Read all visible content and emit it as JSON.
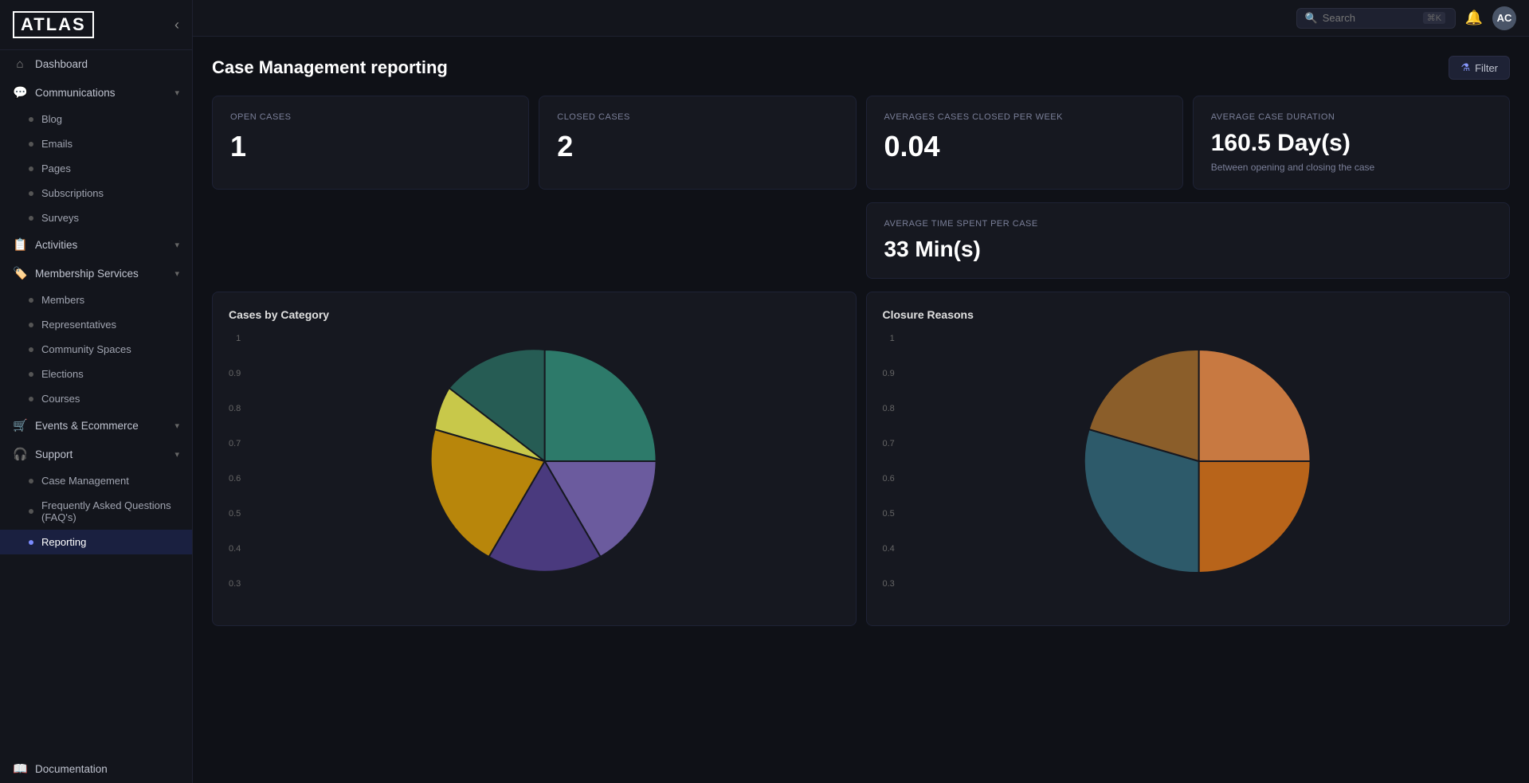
{
  "app": {
    "logo": "ATLAS",
    "page_title": "Case Management reporting"
  },
  "topbar": {
    "search_placeholder": "Search",
    "search_shortcut": "⌘K",
    "avatar_initials": "AC"
  },
  "sidebar": {
    "dashboard_label": "Dashboard",
    "sections": [
      {
        "id": "communications",
        "label": "Communications",
        "icon": "💬",
        "expanded": true,
        "children": [
          {
            "id": "blog",
            "label": "Blog"
          },
          {
            "id": "emails",
            "label": "Emails"
          },
          {
            "id": "pages",
            "label": "Pages"
          },
          {
            "id": "subscriptions",
            "label": "Subscriptions"
          },
          {
            "id": "surveys",
            "label": "Surveys"
          }
        ]
      },
      {
        "id": "activities",
        "label": "Activities",
        "icon": "📋",
        "expanded": false,
        "children": []
      },
      {
        "id": "membership-services",
        "label": "Membership Services",
        "icon": "🏷️",
        "expanded": true,
        "children": [
          {
            "id": "members",
            "label": "Members"
          },
          {
            "id": "representatives",
            "label": "Representatives"
          },
          {
            "id": "community-spaces",
            "label": "Community Spaces"
          },
          {
            "id": "elections",
            "label": "Elections"
          },
          {
            "id": "courses",
            "label": "Courses"
          }
        ]
      },
      {
        "id": "events-ecommerce",
        "label": "Events & Ecommerce",
        "icon": "🛒",
        "expanded": false,
        "children": []
      },
      {
        "id": "support",
        "label": "Support",
        "icon": "🎧",
        "expanded": true,
        "children": [
          {
            "id": "case-management",
            "label": "Case Management"
          },
          {
            "id": "faq",
            "label": "Frequently Asked Questions (FAQ's)"
          },
          {
            "id": "reporting",
            "label": "Reporting",
            "active": true
          }
        ]
      }
    ],
    "bottom_items": [
      {
        "id": "documentation",
        "label": "Documentation",
        "icon": "📖"
      }
    ]
  },
  "stats": {
    "open_cases": {
      "label": "Open Cases",
      "value": "1"
    },
    "closed_cases": {
      "label": "Closed Cases",
      "value": "2"
    },
    "avg_closed_per_week": {
      "label": "Averages cases closed per week",
      "value": "0.04"
    },
    "avg_case_duration": {
      "label": "Average Case duration",
      "value": "160.5 Day(s)",
      "subtitle": "Between opening and closing the case"
    },
    "avg_time_per_case": {
      "label": "Average time spent per case",
      "value": "33 Min(s)"
    }
  },
  "charts": {
    "cases_by_category": {
      "title": "Cases by Category",
      "y_axis": [
        "1",
        "0.9",
        "0.8",
        "0.7",
        "0.6",
        "0.5",
        "0.4",
        "0.3"
      ],
      "colors": [
        "#6b5b9e",
        "#2d7a6a",
        "#b8860b",
        "#c8a84b",
        "#4a7fbf",
        "#7b4ea0"
      ]
    },
    "closure_reasons": {
      "title": "Closure Reasons",
      "y_axis": [
        "1",
        "0.9",
        "0.8",
        "0.7",
        "0.6",
        "0.5",
        "0.4",
        "0.3"
      ],
      "colors": [
        "#c87941",
        "#8b6914",
        "#2d6b7a",
        "#4a5e8a"
      ]
    }
  },
  "filter_button": "Filter"
}
